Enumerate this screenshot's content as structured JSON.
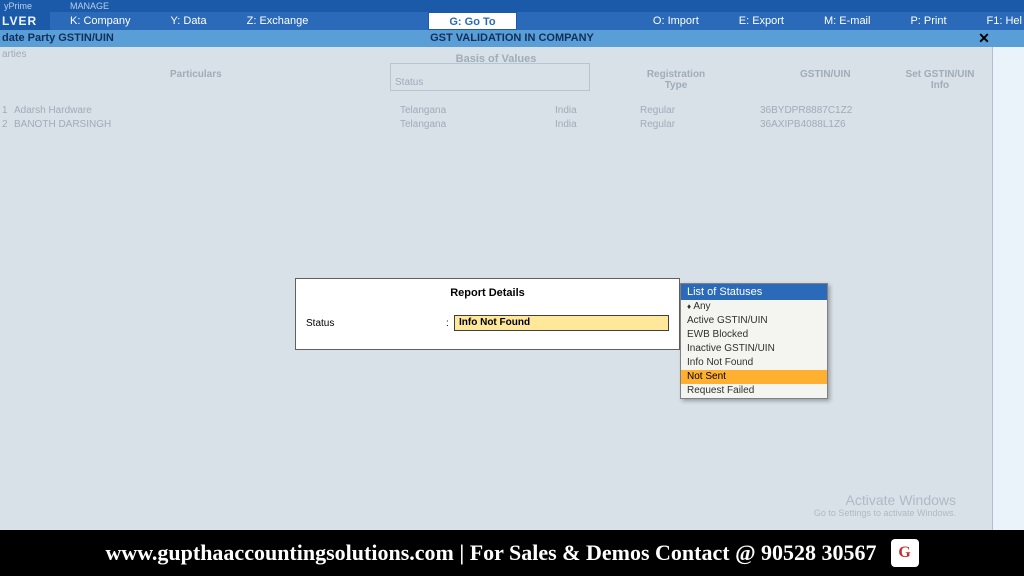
{
  "brand": {
    "line1": "yPrime",
    "line2": "LVER",
    "manage": "MANAGE"
  },
  "menu": {
    "company": "K: Company",
    "data": "Y: Data",
    "exchange": "Z: Exchange",
    "goto": "G: Go To",
    "import": "O: Import",
    "export": "E: Export",
    "email": "M: E-mail",
    "print": "P: Print",
    "help": "F1: Hel"
  },
  "subheader": {
    "left": "date Party GSTIN/UIN",
    "center": "GST VALIDATION IN COMPANY"
  },
  "bg": {
    "parties": "arties",
    "basis": "Basis of Values",
    "headers": {
      "particulars": "Particulars",
      "status": "Status",
      "regtype": "Registration Type",
      "gstin": "GSTIN/UIN",
      "setinfo": "Set GSTIN/UIN Info"
    },
    "rows": [
      {
        "num": "1",
        "name": "Adarsh Hardware",
        "state": "Telangana",
        "country": "India",
        "regtype": "Regular",
        "gstin": "36BYDPR8887C1Z2"
      },
      {
        "num": "2",
        "name": "BANOTH DARSINGH",
        "state": "Telangana",
        "country": "India",
        "regtype": "Regular",
        "gstin": "36AXIPB4088L1Z6"
      }
    ]
  },
  "modal": {
    "title": "Report Details",
    "status_label": "Status",
    "status_value": "Info Not Found"
  },
  "status_list": {
    "header": "List of Statuses",
    "items": [
      "Any",
      "Active GSTIN/UIN",
      "EWB Blocked",
      "Inactive GSTIN/UIN",
      "Info Not Found",
      "Not Sent",
      "Request Failed"
    ],
    "current": "Any",
    "highlighted": "Not Sent"
  },
  "watermark": {
    "line1": "Activate Windows",
    "line2": "Go to Settings to activate Windows."
  },
  "footer": {
    "text": "www.gupthaaccountingsolutions.com | For Sales & Demos Contact @ 90528 30567",
    "logo": "G"
  }
}
